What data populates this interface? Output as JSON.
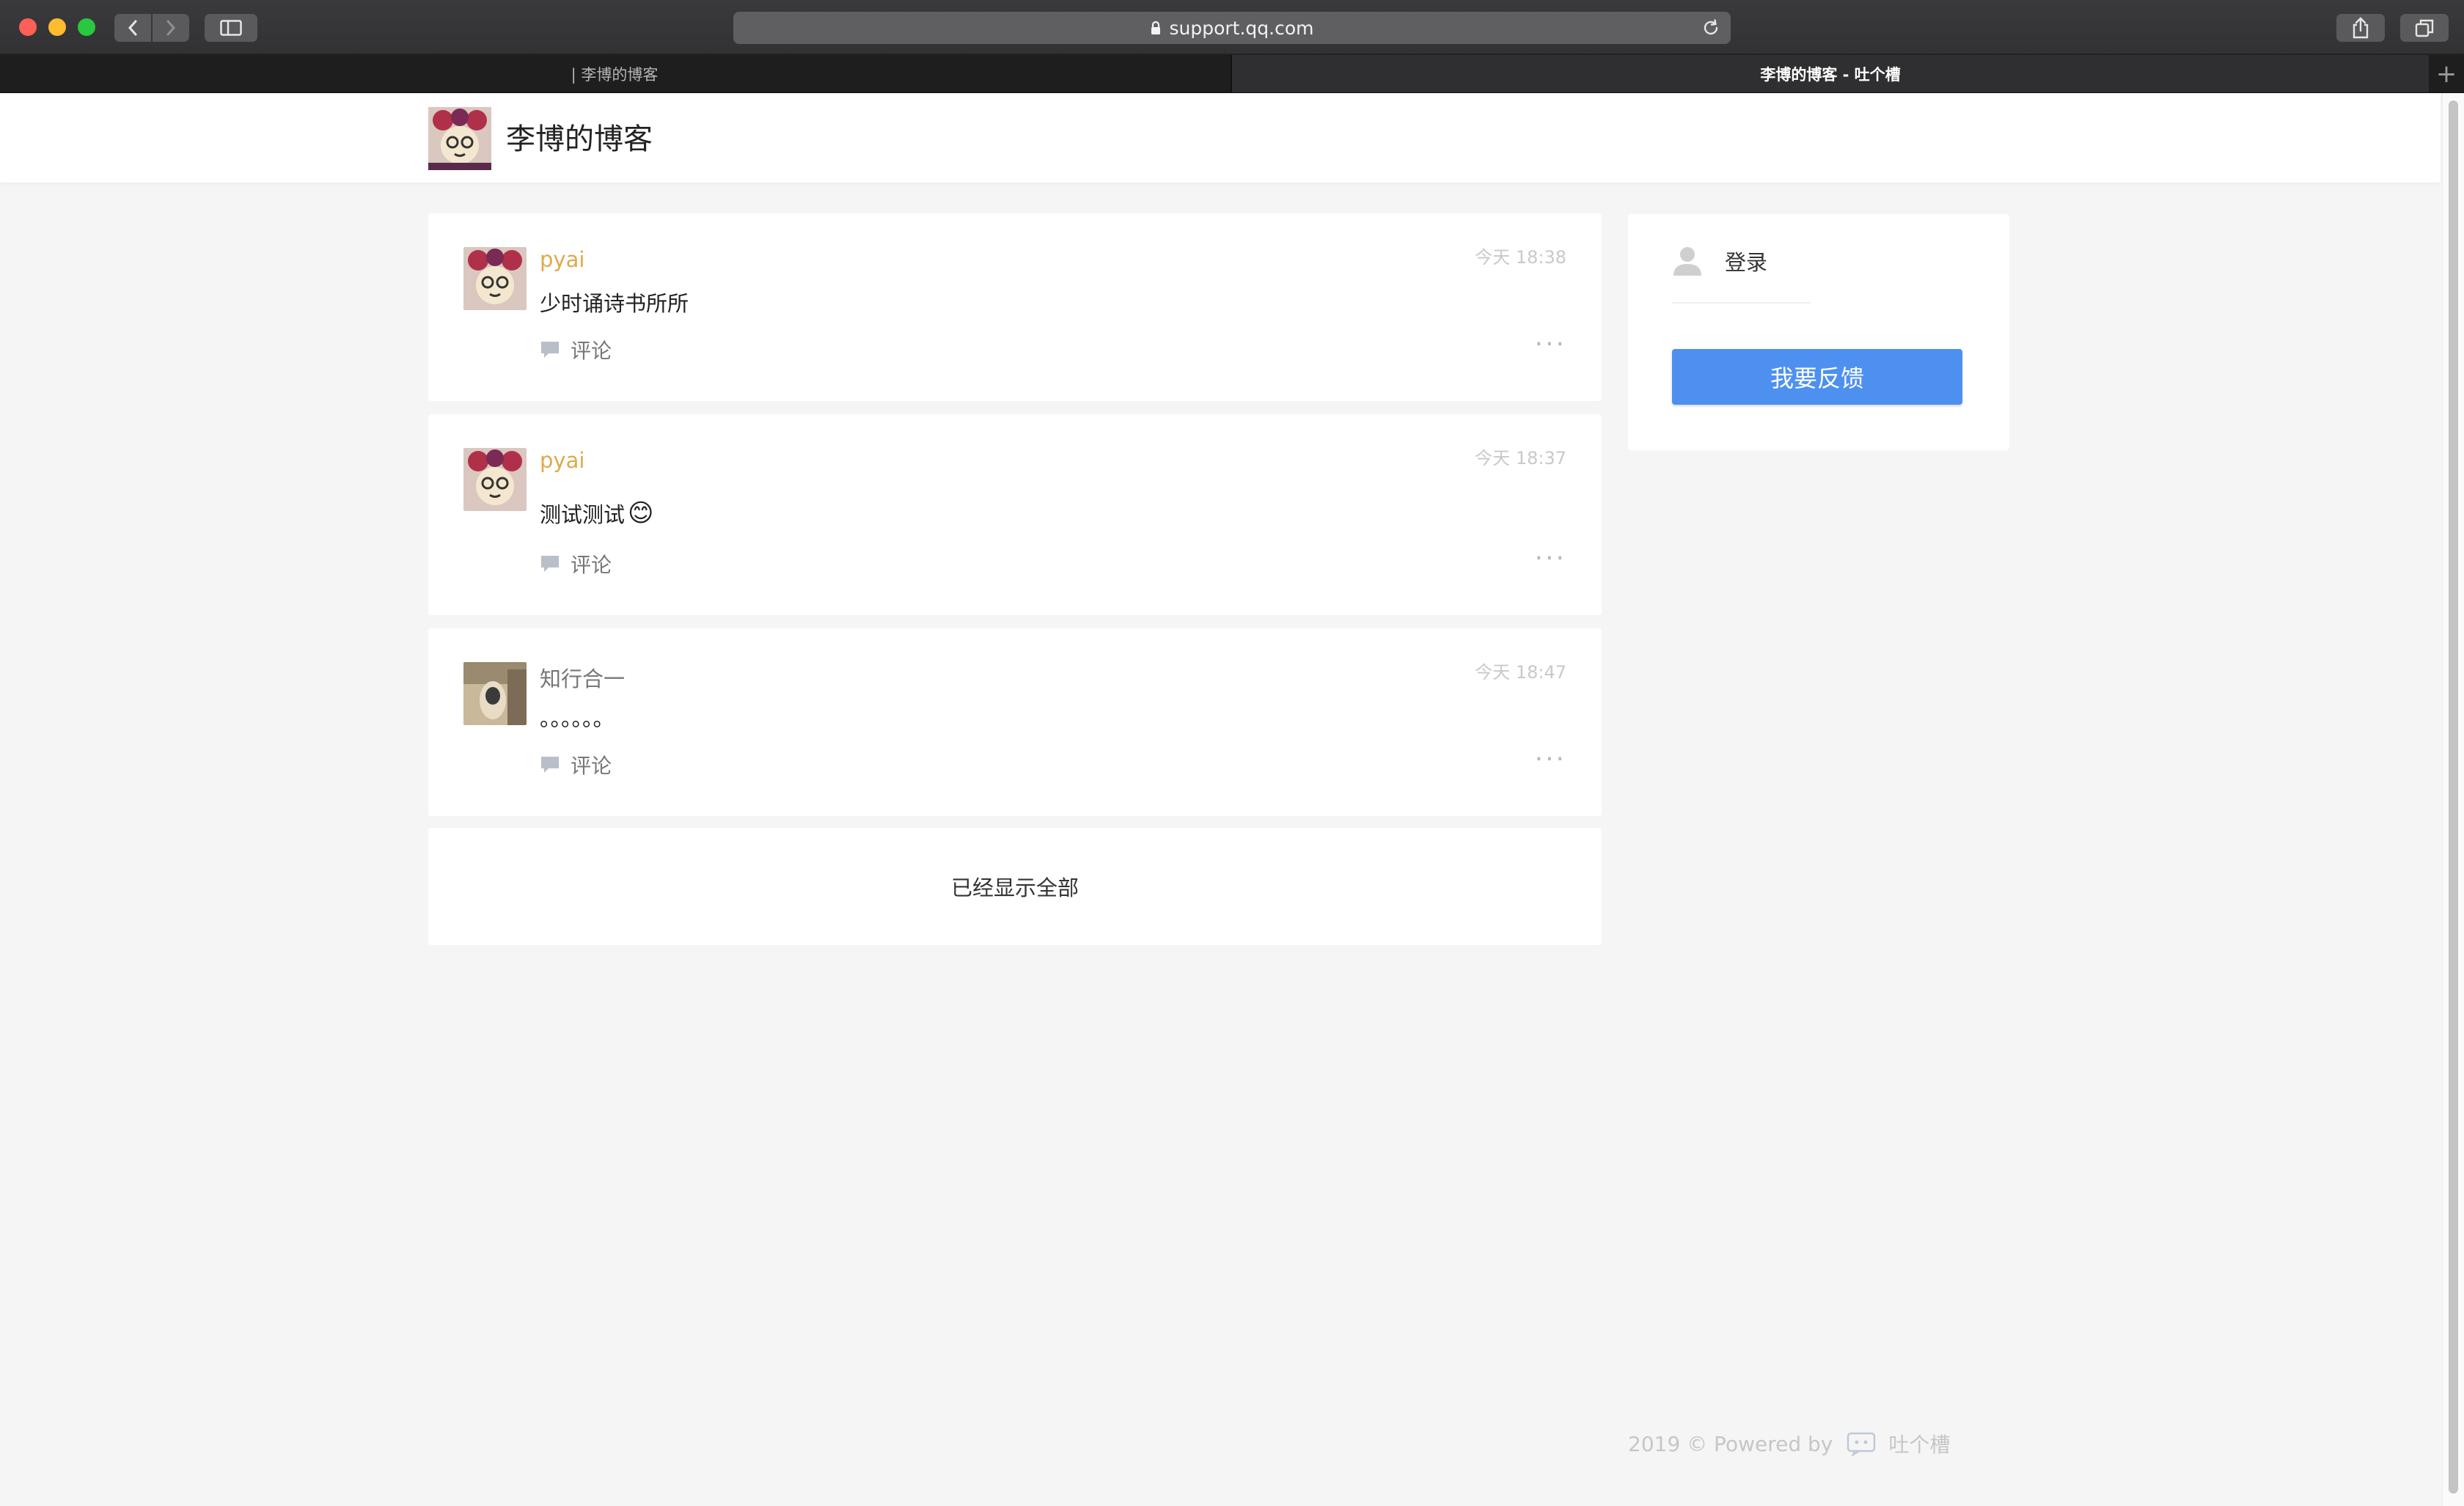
{
  "browser": {
    "url": "support.qq.com",
    "tabs": [
      {
        "label": "| 李博的博客"
      },
      {
        "label": "李博的博客 - 吐个槽"
      }
    ]
  },
  "site": {
    "title": "李博的博客"
  },
  "posts": [
    {
      "author": "pyai",
      "time": "今天 18:38",
      "content": "少时诵诗书所所",
      "comment_label": "评论",
      "more": "···"
    },
    {
      "author": "pyai",
      "time": "今天 18:37",
      "content": "测试测试",
      "emoji": "😊",
      "comment_label": "评论",
      "more": "···"
    },
    {
      "author": "知行合一",
      "time": "今天 18:47",
      "content": "。。。。。。",
      "comment_label": "评论",
      "more": "···"
    }
  ],
  "list_end_text": "已经显示全部",
  "sidebar": {
    "login_label": "登录",
    "feedback_button": "我要反馈"
  },
  "footer": {
    "powered_text": "2019 © Powered by",
    "brand": "吐个槽"
  },
  "colors": {
    "author_name": "#e0a94b",
    "primary_button": "#4d90f0"
  }
}
